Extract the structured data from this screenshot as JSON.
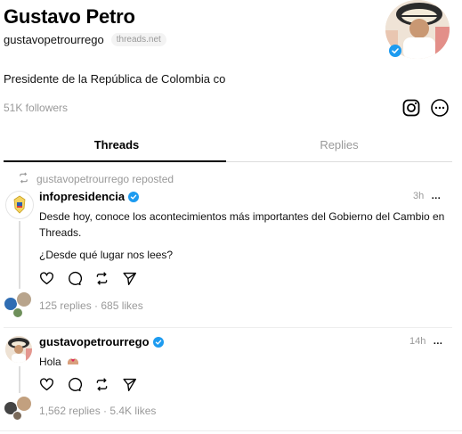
{
  "profile": {
    "name": "Gustavo Petro",
    "handle": "gustavopetrourrego",
    "domain_badge": "threads.net",
    "bio": "Presidente de la República de Colombia co",
    "followers": "51K followers"
  },
  "tabs": [
    {
      "label": "Threads",
      "active": true
    },
    {
      "label": "Replies",
      "active": false
    }
  ],
  "posts": [
    {
      "repost_text": "gustavopetrourrego reposted",
      "username": "infopresidencia",
      "time": "3h",
      "text1": "Desde hoy, conoce los acontecimientos más importantes del Gobierno del Cambio en Threads.",
      "text2": "¿Desde qué lugar nos lees?",
      "stats": "125 replies · 685 likes"
    },
    {
      "username": "gustavopetrourrego",
      "time": "14h",
      "text1": "Hola",
      "stats": "1,562 replies · 5.4K likes"
    }
  ],
  "icons": {
    "more": "…",
    "verified_color": "#1d9bf0"
  }
}
